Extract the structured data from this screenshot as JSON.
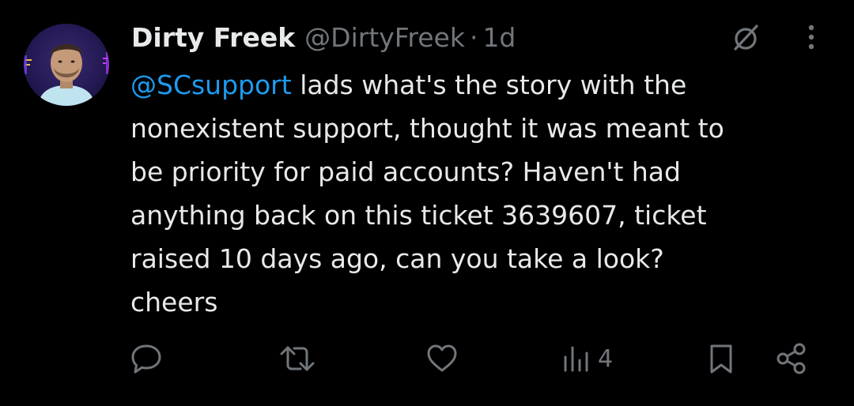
{
  "author": {
    "display_name": "Dirty Freek",
    "handle": "@DirtyFreek",
    "separator": "·",
    "time": "1d",
    "avatar_icon": "avatar-photo-icon"
  },
  "tweet": {
    "line1_mention": "@SCsupport",
    "line1_rest": " lads what's the story with the",
    "line2": "nonexistent support, thought it was meant to",
    "line3": "be priority for paid accounts? Haven't had",
    "line4": "anything back on this ticket 3639607, ticket",
    "line5": "raised 10 days ago, can you take a look?",
    "line6": "cheers"
  },
  "actions": {
    "views_count": "4"
  },
  "icons": {
    "grok": "grok-icon",
    "more": "more-options-icon",
    "reply": "reply-icon",
    "retweet": "retweet-icon",
    "like": "like-icon",
    "views": "views-icon",
    "bookmark": "bookmark-icon",
    "share": "share-icon"
  },
  "colors": {
    "background": "#000000",
    "text_primary": "#e7e9ea",
    "text_secondary": "#71767b",
    "link": "#1d9bf0"
  }
}
